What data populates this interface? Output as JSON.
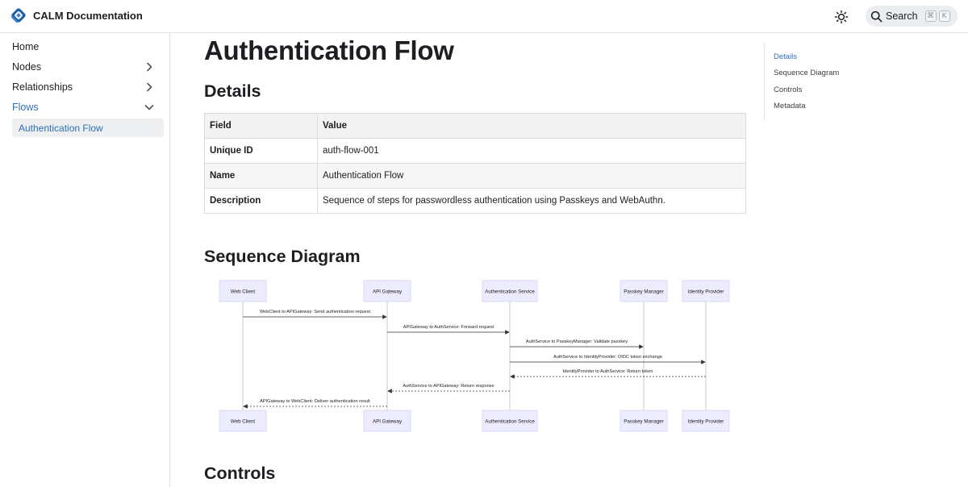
{
  "header": {
    "brand": "CALM Documentation",
    "search_label": "Search",
    "search_keys": [
      "⌘",
      "K"
    ]
  },
  "sidebar": {
    "items": [
      {
        "label": "Home"
      },
      {
        "label": "Nodes"
      },
      {
        "label": "Relationships"
      },
      {
        "label": "Flows"
      }
    ],
    "sub_items": [
      {
        "label": "Authentication Flow"
      }
    ]
  },
  "main": {
    "title": "Authentication Flow",
    "details_heading": "Details",
    "table": {
      "headers": [
        "Field",
        "Value"
      ],
      "rows": [
        [
          "Unique ID",
          "auth-flow-001"
        ],
        [
          "Name",
          "Authentication Flow"
        ],
        [
          "Description",
          "Sequence of steps for passwordless authentication using Passkeys and WebAuthn."
        ]
      ]
    },
    "sequence_heading": "Sequence Diagram",
    "controls_heading": "Controls"
  },
  "diagram": {
    "participants": [
      "Web Client",
      "API Gateway",
      "Authentication Service",
      "Passkey Manager",
      "Identity Provider"
    ],
    "messages": [
      {
        "text": "WebClient to APIGateway: Send authentication request"
      },
      {
        "text": "APIGateway to AuthService: Forward request"
      },
      {
        "text": "AuthService to PasskeyManager: Validate passkey"
      },
      {
        "text": "AuthService to IdentityProvider: OIDC token exchange"
      },
      {
        "text": "IdentityProvider to AuthService: Return token"
      },
      {
        "text": "AuthService to APIGateway: Return response"
      },
      {
        "text": "APIGateway to WebClient: Deliver authentication result"
      }
    ]
  },
  "toc": {
    "items": [
      "Details",
      "Sequence Diagram",
      "Controls",
      "Metadata"
    ]
  },
  "colors": {
    "accent": "#2e6fb9",
    "participant_fill": "#ececfe",
    "participant_stroke": "#d9d9f5"
  }
}
